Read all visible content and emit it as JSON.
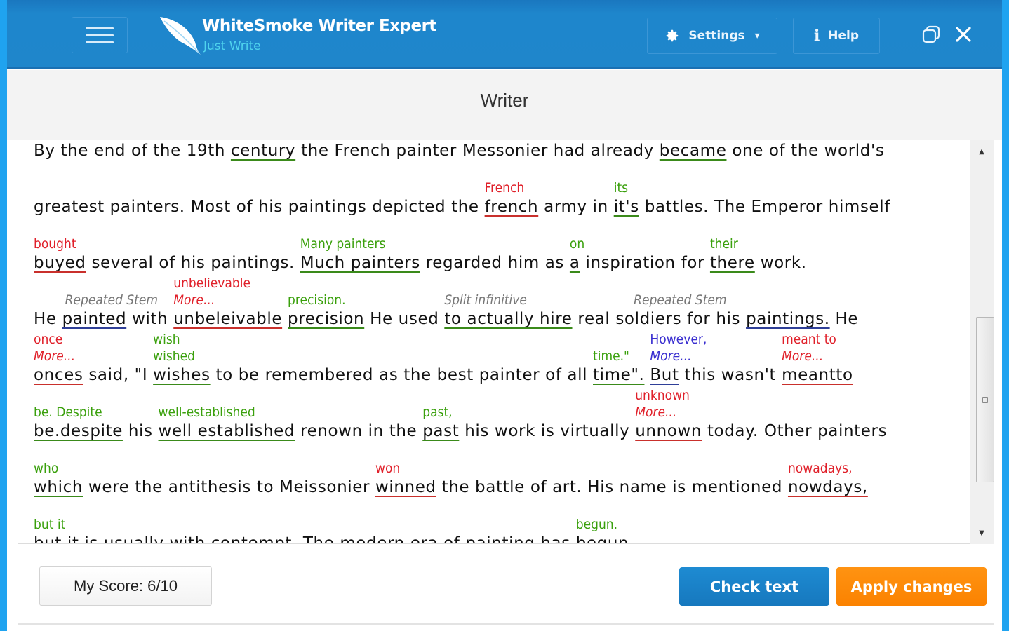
{
  "app": {
    "title": "WhiteSmoke Writer Expert",
    "subtitle": "Just Write",
    "colors": {
      "brand": "#1f86cb",
      "accent_light": "#4fd4ee",
      "apply": "#fb8200",
      "check": "#1678be",
      "error": "#e0202a",
      "suggestion": "#3aa00c",
      "style": "#3a2fd0"
    }
  },
  "header": {
    "menu_icon": "hamburger-icon",
    "settings_label": "Settings",
    "settings_icon": "gear-icon",
    "help_label": "Help",
    "help_icon": "info-icon",
    "restore_icon": "restore-window-icon",
    "close_icon": "close-icon"
  },
  "panel": {
    "title": "Writer"
  },
  "editor": {
    "lines": [
      {
        "segments": [
          {
            "text": "By the end of the 19th "
          },
          {
            "text": "century",
            "mark": "green"
          },
          {
            "text": " the French painter Messonier had already "
          },
          {
            "text": "became",
            "mark": "green"
          },
          {
            "text": " one of the world's"
          }
        ]
      },
      {
        "segments": [
          {
            "text": "greatest painters. Most of his paintings depicted the "
          },
          {
            "text": "french",
            "mark": "red",
            "suggestion": "French"
          },
          {
            "text": " army in "
          },
          {
            "text": "it's",
            "mark": "green",
            "suggestion": "its"
          },
          {
            "text": " battles. The Emperor himself"
          }
        ]
      },
      {
        "segments": [
          {
            "text": "buyed",
            "mark": "red",
            "suggestion": "bought"
          },
          {
            "text": " several of his paintings. "
          },
          {
            "text": "Much painters",
            "mark": "green",
            "suggestion": "Many painters"
          },
          {
            "text": " regarded him as "
          },
          {
            "text": "a",
            "mark": "green",
            "suggestion": "on"
          },
          {
            "text": " inspiration for "
          },
          {
            "text": "there",
            "mark": "green",
            "suggestion": "their"
          },
          {
            "text": " work."
          }
        ]
      },
      {
        "segments": [
          {
            "text": "He "
          },
          {
            "text": "painted",
            "mark": "blue",
            "note": "Repeated Stem"
          },
          {
            "text": " with "
          },
          {
            "text": "unbeleivable",
            "mark": "red",
            "suggestion": "unbelievable",
            "more": "More..."
          },
          {
            "text": " "
          },
          {
            "text": "precision",
            "mark": "green",
            "suggestion": "precision."
          },
          {
            "text": " He used "
          },
          {
            "text": "to actually hire",
            "mark": "green",
            "note": "Split infinitive"
          },
          {
            "text": " real soldiers for his "
          },
          {
            "text": "paintings.",
            "mark": "blue",
            "note": "Repeated Stem"
          },
          {
            "text": " He"
          }
        ]
      },
      {
        "segments": [
          {
            "text": "onces",
            "mark": "red",
            "suggestion": "once",
            "more": "More..."
          },
          {
            "text": " said, \"I "
          },
          {
            "text": "wishes",
            "mark": "green",
            "suggestion": "wish",
            "suggestion2": "wished"
          },
          {
            "text": " to be remembered as the best painter of all "
          },
          {
            "text": "time\".",
            "mark": "green",
            "suggestion": "time.\""
          },
          {
            "text": " "
          },
          {
            "text": "But",
            "mark": "blue",
            "suggestion": "However,",
            "more": "More..."
          },
          {
            "text": " this wasn't "
          },
          {
            "text": "meantto",
            "mark": "red",
            "suggestion": "meant to",
            "more": "More..."
          }
        ]
      },
      {
        "segments": [
          {
            "text": "be.despite",
            "mark": "green",
            "suggestion": "be. Despite"
          },
          {
            "text": " his "
          },
          {
            "text": "well established",
            "mark": "green",
            "suggestion": "well-established"
          },
          {
            "text": " renown in the "
          },
          {
            "text": "past",
            "mark": "green",
            "suggestion": "past,"
          },
          {
            "text": " his work is virtually "
          },
          {
            "text": "unnown",
            "mark": "red",
            "suggestion": "unknown",
            "more": "More..."
          },
          {
            "text": " today. Other painters"
          }
        ]
      },
      {
        "segments": [
          {
            "text": "which",
            "mark": "green",
            "suggestion": "who"
          },
          {
            "text": " were the antithesis to Meissonier "
          },
          {
            "text": "winned",
            "mark": "red",
            "suggestion": "won"
          },
          {
            "text": " the battle of art. His name is mentioned "
          },
          {
            "text": "nowdays,",
            "mark": "red",
            "suggestion": "nowadays,"
          }
        ]
      },
      {
        "segments": [
          {
            "text": "but it",
            "mark": "green",
            "suggestion": "but it"
          },
          {
            "text": " is usually with contempt. The modern era of painting has "
          },
          {
            "text": "begun",
            "mark": "green",
            "suggestion": "begun."
          }
        ]
      }
    ]
  },
  "footer": {
    "score_label": "My Score: 6/10",
    "check_label": "Check text",
    "apply_label": "Apply changes"
  }
}
